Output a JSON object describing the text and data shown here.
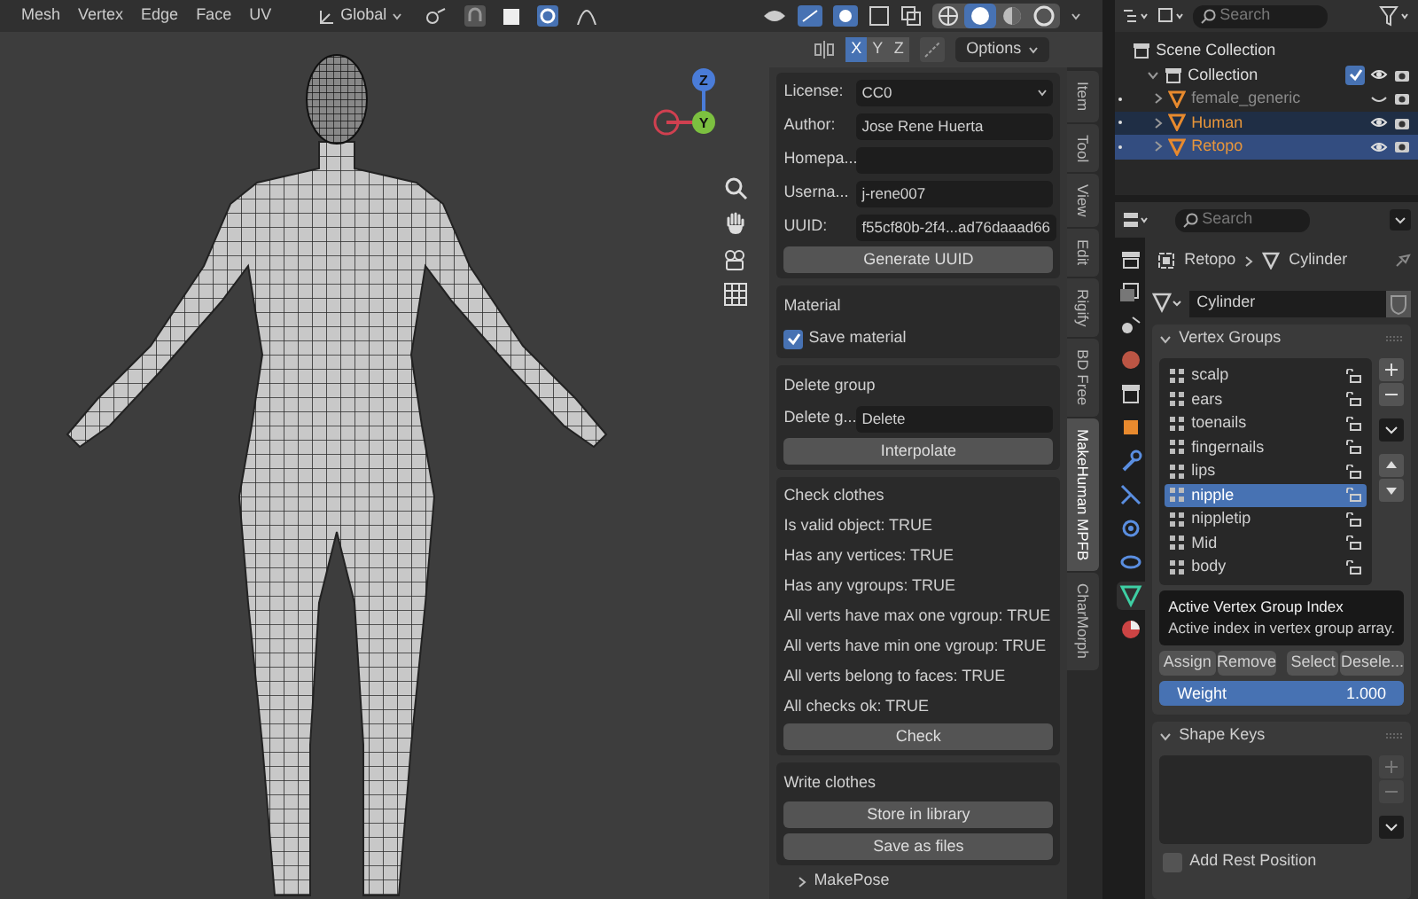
{
  "header_menu": [
    "Mesh",
    "Vertex",
    "Edge",
    "Face",
    "UV"
  ],
  "transform_orientation": "Global",
  "shading_modes": [
    {
      "selected": false
    },
    {
      "selected": true
    },
    {
      "selected": false
    },
    {
      "selected": false
    }
  ],
  "axis_buttons": [
    {
      "label": "X",
      "selected": true
    },
    {
      "label": "Y",
      "selected": false
    },
    {
      "label": "Z",
      "selected": false
    }
  ],
  "options_label": "Options",
  "gizmo_labels": [
    "Z",
    "Y"
  ],
  "addon_panel": {
    "properties": [
      {
        "label": "License:",
        "value": "CC0",
        "kind": "dropdown"
      },
      {
        "label": "Author:",
        "value": "Jose Rene Huerta",
        "kind": "text"
      },
      {
        "label": "Homepa...",
        "kind": "text"
      },
      {
        "label": "Userna...",
        "value": "j-rene007",
        "kind": "text"
      },
      {
        "label": "UUID:",
        "value": "f55cf80b-2f4...ad76daaad66",
        "kind": "text"
      }
    ],
    "generate_button": "Generate UUID",
    "material": {
      "title": "Material",
      "save_material": {
        "label": "Save material",
        "checked": true
      }
    },
    "delete_group": {
      "title": "Delete group",
      "field": {
        "label": "Delete g...",
        "value": "Delete"
      },
      "button": "Interpolate"
    },
    "check_clothes": {
      "title": "Check clothes",
      "results": [
        "Is valid object: TRUE",
        "Has any vertices: TRUE",
        "Has any vgroups: TRUE",
        "All verts have max one vgroup: TRUE",
        "All verts have min one vgroup: TRUE",
        "All verts belong to faces: TRUE",
        "All checks ok: TRUE"
      ],
      "button": "Check"
    },
    "write_clothes": {
      "title": "Write clothes",
      "buttons": [
        "Store in library",
        "Save as files"
      ]
    },
    "next_panel": "MakePose"
  },
  "sidebar_tabs": [
    {
      "label": "Item",
      "selected": false
    },
    {
      "label": "Tool",
      "selected": false
    },
    {
      "label": "View",
      "selected": false
    },
    {
      "label": "Edit",
      "selected": false
    },
    {
      "label": "Rigify",
      "selected": false
    },
    {
      "label": "BD Free",
      "selected": false
    },
    {
      "label": "MakeHuman MPFB",
      "selected": true
    },
    {
      "label": "CharMorph",
      "selected": false
    }
  ],
  "outliner": {
    "search_placeholder": "Search",
    "tree": [
      {
        "label": "Scene Collection",
        "children": [
          {
            "label": "Collection",
            "checked": true,
            "children": [
              {
                "label": "female_generic",
                "selected": false,
                "active": false,
                "hidden": true
              },
              {
                "label": "Human",
                "selected": true,
                "active": false,
                "hidden": false
              },
              {
                "label": "Retopo",
                "selected": true,
                "active": true,
                "hidden": false
              }
            ]
          }
        ]
      }
    ]
  },
  "properties": {
    "search_placeholder": "Search",
    "tabs": [
      {
        "selected": false
      },
      {
        "selected": false
      },
      {
        "selected": false
      },
      {
        "selected": false
      },
      {
        "selected": false
      },
      {
        "selected": false
      },
      {
        "selected": false
      },
      {
        "selected": false
      },
      {
        "selected": false
      },
      {
        "selected": false
      },
      {
        "selected": true
      },
      {
        "selected": false
      }
    ],
    "breadcrumb": [
      "Retopo",
      "Cylinder"
    ],
    "mesh_name": "Cylinder",
    "vertex_groups": {
      "title": "Vertex Groups",
      "items": [
        {
          "label": "scalp",
          "selected": false
        },
        {
          "label": "ears",
          "selected": false
        },
        {
          "label": "toenails",
          "selected": false
        },
        {
          "label": "fingernails",
          "selected": false
        },
        {
          "label": "lips",
          "selected": false
        },
        {
          "label": "nipple",
          "selected": true
        },
        {
          "label": "nippletip",
          "selected": false
        },
        {
          "label": "Mid",
          "selected": false
        },
        {
          "label": "body",
          "selected": false
        }
      ],
      "tooltip": {
        "title": "Active Vertex Group Index",
        "text": "Active index in vertex group array."
      },
      "buttons": [
        "Assign",
        "Remove",
        "Select",
        "Desele..."
      ],
      "weight": {
        "label": "Weight",
        "reading": "1.000",
        "level": 1.0
      }
    },
    "shape_keys": {
      "title": "Shape Keys",
      "add_rest_position": {
        "label": "Add Rest Position",
        "checked": false
      }
    }
  }
}
